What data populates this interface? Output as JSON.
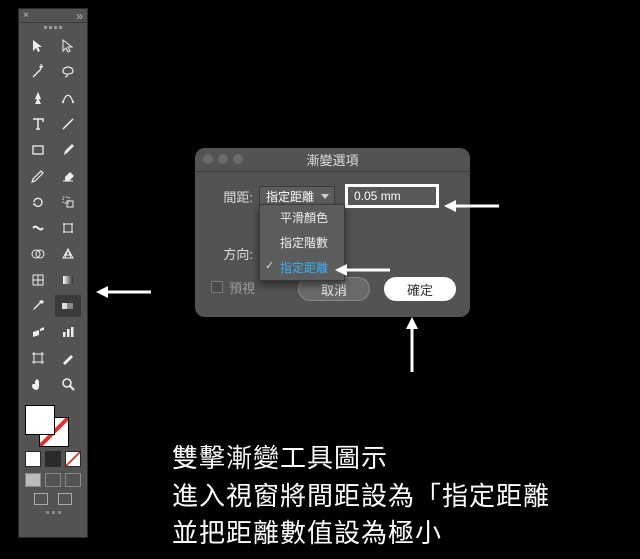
{
  "dialog": {
    "title": "漸變選項",
    "spacing_label": "間距:",
    "spacing_value_selected": "指定距離",
    "number_value": "0.05 mm",
    "direction_label": "方向:",
    "options": {
      "smooth": "平滑顏色",
      "steps": "指定階數",
      "distance": "指定距離"
    },
    "preview_label": "預視",
    "cancel": "取消",
    "ok": "確定"
  },
  "caption": {
    "line1": "雙擊漸變工具圖示",
    "line2": "進入視窗將間距設為「指定距離",
    "line3": "並把距離數值設為極小"
  },
  "tools": [
    "selection",
    "direct-selection",
    "magic-wand",
    "lasso",
    "pen",
    "curvature-pen",
    "type",
    "line-segment",
    "rectangle",
    "paintbrush",
    "shaper",
    "eraser",
    "rotate",
    "scale",
    "width",
    "free-transform",
    "shape-builder",
    "perspective-grid",
    "mesh",
    "gradient",
    "eyedropper",
    "blend",
    "symbol-sprayer",
    "column-graph",
    "artboard",
    "slice",
    "hand",
    "zoom"
  ],
  "icons": {
    "blend": "blend-icon"
  }
}
